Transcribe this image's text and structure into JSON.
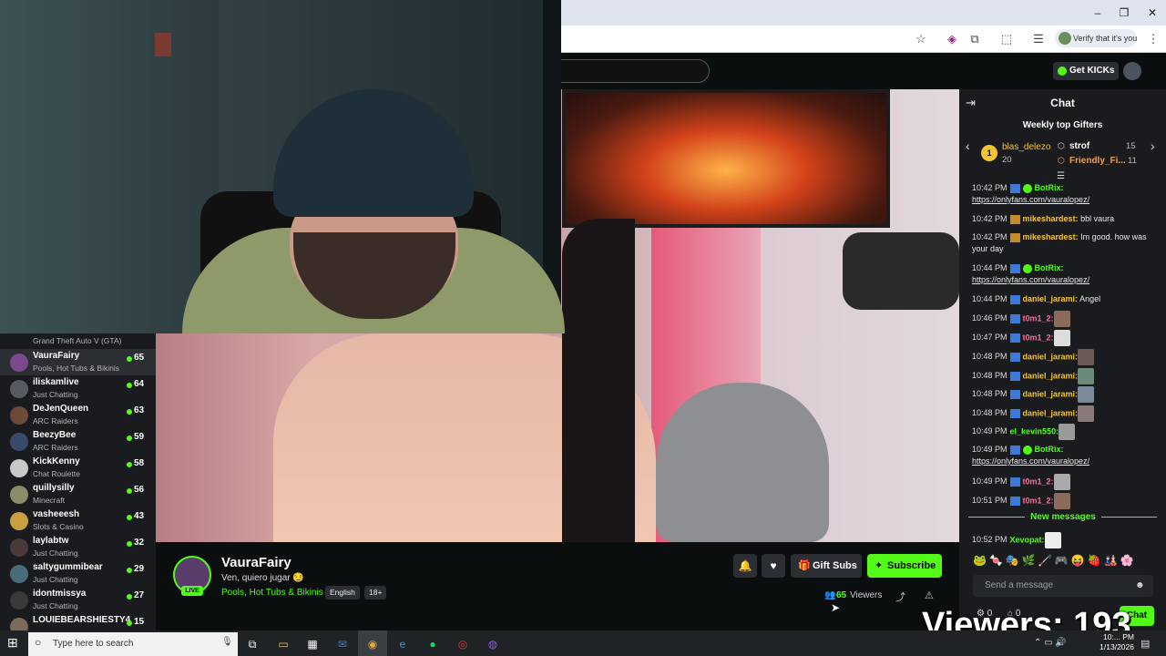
{
  "browser": {
    "verify_label": "Verify that it's you",
    "min_icon": "minimize-icon",
    "restore_icon": "restore-icon",
    "close_icon": "close-icon"
  },
  "kick": {
    "get_kicks_label": "Get KICKs"
  },
  "sidebar": {
    "first_category": "Grand Theft Auto V (GTA)",
    "channels": [
      {
        "name": "VauraFairy",
        "category": "Pools, Hot Tubs & Bikinis",
        "viewers": "65",
        "active": true,
        "avatar_color": "#7a4a8c"
      },
      {
        "name": "iliskamlive",
        "category": "Just Chatting",
        "viewers": "64",
        "avatar_color": "#555b60"
      },
      {
        "name": "DeJenQueen",
        "category": "ARC Raiders",
        "viewers": "63",
        "avatar_color": "#6b4a3a"
      },
      {
        "name": "BeezyBee",
        "category": "ARC Raiders",
        "viewers": "59",
        "avatar_color": "#3a4a6b"
      },
      {
        "name": "KickKenny",
        "category": "Chat Roulette",
        "viewers": "58",
        "avatar_color": "#c8c8c8"
      },
      {
        "name": "quillysilly",
        "category": "Minecraft",
        "viewers": "56",
        "avatar_color": "#8c8c6b"
      },
      {
        "name": "vasheeesh",
        "category": "Slots & Casino",
        "viewers": "43",
        "avatar_color": "#c8a040"
      },
      {
        "name": "laylabtw",
        "category": "Just Chatting",
        "viewers": "32",
        "avatar_color": "#4a3a3a"
      },
      {
        "name": "saltygummibear",
        "category": "Just Chatting",
        "viewers": "29",
        "avatar_color": "#4a6b7a"
      },
      {
        "name": "idontmissya",
        "category": "Just Chatting",
        "viewers": "27",
        "avatar_color": "#3a3a3a"
      },
      {
        "name": "LOUIEBEARSHIESTY4",
        "category": "",
        "viewers": "15",
        "avatar_color": "#7a6b5a"
      }
    ]
  },
  "stream": {
    "streamer": "VauraFairy",
    "live_label": "LIVE",
    "title": "Ven, quiero jugar 😏",
    "category": "Pools, Hot Tubs & Bikinis",
    "tags": [
      "English",
      "18+"
    ],
    "gift_subs_label": "Gift Subs",
    "subscribe_label": "Subscribe",
    "viewer_count": "65",
    "viewers_label": "Viewers"
  },
  "chat": {
    "title": "Chat",
    "gifters_title": "Weekly top Gifters",
    "gifters": [
      {
        "rank": "1",
        "name": "blas_delezo",
        "count": "20"
      },
      {
        "name": "strof",
        "count": "15"
      },
      {
        "name": "Friendly_Fi...",
        "count": "11"
      }
    ],
    "messages": [
      {
        "time": "10:42 PM",
        "user": "BotRix:",
        "text": "",
        "color": "#53fc18",
        "link": "https://onlyfans.com/vauralopez/"
      },
      {
        "time": "10:42 PM",
        "user": "mikeshardest:",
        "text": "bbl vaura",
        "color": "#f4c430"
      },
      {
        "time": "10:42 PM",
        "user": "mikeshardest:",
        "text": "Im good. how was your day",
        "color": "#f4c430"
      },
      {
        "time": "10:44 PM",
        "user": "BotRix:",
        "text": "",
        "color": "#53fc18",
        "link": "https://onlyfans.com/vauralopez/"
      },
      {
        "time": "10:44 PM",
        "user": "daniel_jarami:",
        "text": "Angel",
        "color": "#f4c430"
      },
      {
        "time": "10:46 PM",
        "user": "t0m1_2:",
        "text": "",
        "color": "#ff6b9a",
        "emote": true
      },
      {
        "time": "10:47 PM",
        "user": "t0m1_2:",
        "text": "",
        "color": "#ff6b9a",
        "emote": true
      },
      {
        "time": "10:48 PM",
        "user": "daniel_jarami:",
        "text": "",
        "color": "#f4c430",
        "emote": true
      },
      {
        "time": "10:48 PM",
        "user": "daniel_jarami:",
        "text": "",
        "color": "#f4c430",
        "emote": true
      },
      {
        "time": "10:48 PM",
        "user": "daniel_jarami:",
        "text": "",
        "color": "#f4c430",
        "emote": true
      },
      {
        "time": "10:48 PM",
        "user": "daniel_jarami:",
        "text": "",
        "color": "#f4c430",
        "emote": true
      },
      {
        "time": "10:49 PM",
        "user": "el_kevin550:",
        "text": "",
        "color": "#53fc18",
        "emote": true
      },
      {
        "time": "10:49 PM",
        "user": "BotRix:",
        "text": "",
        "color": "#53fc18",
        "link": "https://onlyfans.com/vauralopez/"
      },
      {
        "time": "10:49 PM",
        "user": "t0m1_2:",
        "text": "",
        "color": "#ff6b9a",
        "emote": true
      },
      {
        "time": "10:51 PM",
        "user": "t0m1_2:",
        "text": "",
        "color": "#ff6b9a",
        "emote": true
      }
    ],
    "new_messages_label": "New messages",
    "after_messages": [
      {
        "time": "10:52 PM",
        "user": "Xevopat:",
        "text": "",
        "color": "#53fc18",
        "emote": true
      }
    ],
    "emote_row": "🐸🍬🎭🌿🦯🎮😝🍓🎎🌸",
    "input_placeholder": "Send a message",
    "count_1": "0",
    "count_2": "0",
    "send_label": "Chat"
  },
  "overlay": {
    "viewers_text": "Viewers: 193"
  },
  "taskbar": {
    "search_placeholder": "Type here to search",
    "time": "10:... PM",
    "date": "1/13/2026"
  }
}
